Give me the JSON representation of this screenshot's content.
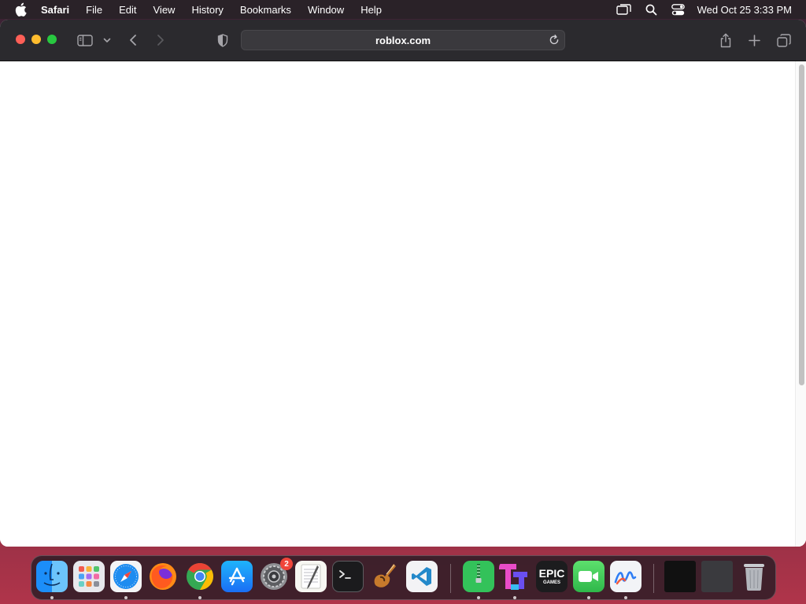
{
  "menubar": {
    "apple_icon": "apple-logo-icon",
    "app_name": "Safari",
    "items": [
      {
        "label": "File"
      },
      {
        "label": "Edit"
      },
      {
        "label": "View"
      },
      {
        "label": "History"
      },
      {
        "label": "Bookmarks"
      },
      {
        "label": "Window"
      },
      {
        "label": "Help"
      }
    ],
    "status_icons": [
      "screen-mirroring-icon",
      "spotlight-search-icon",
      "control-center-icon"
    ],
    "clock": "Wed Oct 25  3:33 PM"
  },
  "safari": {
    "url": "roblox.com",
    "toolbar_icons": [
      "sidebar-icon",
      "chevron-down-icon",
      "back-arrow-icon",
      "forward-arrow-icon",
      "privacy-shield-icon",
      "reload-icon",
      "share-icon",
      "new-tab-icon",
      "tab-overview-icon"
    ],
    "page_scroll_fraction": 0.67
  },
  "dock": {
    "apps": [
      {
        "name": "Finder",
        "icon": "finder-icon",
        "running": true
      },
      {
        "name": "Launchpad",
        "icon": "launchpad-icon",
        "running": false
      },
      {
        "name": "Safari",
        "icon": "safari-icon",
        "running": true
      },
      {
        "name": "Firefox",
        "icon": "firefox-icon",
        "running": false
      },
      {
        "name": "Google Chrome",
        "icon": "chrome-icon",
        "running": true
      },
      {
        "name": "App Store",
        "icon": "app-store-icon",
        "running": false
      },
      {
        "name": "System Settings",
        "icon": "system-settings-icon",
        "running": false,
        "badge": "2"
      },
      {
        "name": "TextEdit",
        "icon": "textedit-icon",
        "running": false
      },
      {
        "name": "Terminal",
        "icon": "terminal-icon",
        "running": false
      },
      {
        "name": "GarageBand",
        "icon": "garageband-icon",
        "running": false
      },
      {
        "name": "Visual Studio Code",
        "icon": "vscode-icon",
        "running": false
      },
      {
        "name": "Archive Utility",
        "icon": "archive-utility-icon",
        "running": true
      },
      {
        "name": "Tetris",
        "icon": "tetris-icon",
        "running": true
      },
      {
        "name": "Epic Games Launcher",
        "icon": "epic-games-icon",
        "running": false,
        "logo_text": "EPIC",
        "logo_subtext": "GAMES"
      },
      {
        "name": "FaceTime",
        "icon": "facetime-icon",
        "running": true
      },
      {
        "name": "Freeform",
        "icon": "freeform-icon",
        "running": true
      }
    ],
    "minimized_windows": [
      "minimized-window-thumbnail-icon",
      "minimized-window-thumbnail-icon"
    ],
    "trash_icon": "trash-icon"
  }
}
